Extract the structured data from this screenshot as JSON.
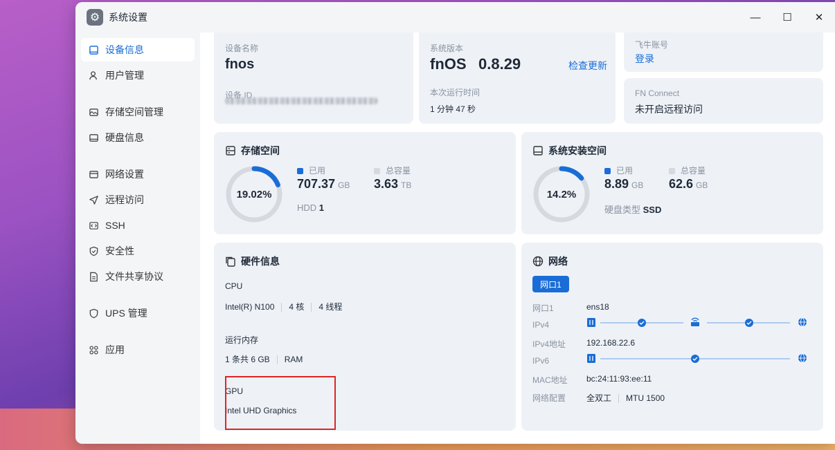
{
  "window": {
    "title": "系统设置",
    "controls": [
      "—",
      "☐",
      "✕"
    ]
  },
  "sidebar": {
    "items": [
      {
        "label": "设备信息",
        "icon": "device-icon",
        "active": true
      },
      {
        "label": "用户管理",
        "icon": "user-icon"
      },
      {
        "label": "存储空间管理",
        "icon": "storage-icon"
      },
      {
        "label": "硬盘信息",
        "icon": "disk-icon"
      },
      {
        "label": "网络设置",
        "icon": "network-icon"
      },
      {
        "label": "远程访问",
        "icon": "send-icon"
      },
      {
        "label": "SSH",
        "icon": "code-icon"
      },
      {
        "label": "安全性",
        "icon": "shield-icon"
      },
      {
        "label": "文件共享协议",
        "icon": "file-icon"
      },
      {
        "label": "UPS 管理",
        "icon": "ups-shield-icon"
      },
      {
        "label": "应用",
        "icon": "apps-icon"
      }
    ]
  },
  "device": {
    "name_label": "设备名称",
    "name": "fnos",
    "id_label": "设备 ID"
  },
  "system": {
    "version_label": "系统版本",
    "os": "fnOS",
    "version": "0.8.29",
    "check_update": "检查更新",
    "uptime_label": "本次运行时间",
    "uptime": "1 分钟 47 秒"
  },
  "account": {
    "label": "飞牛账号",
    "login": "登录"
  },
  "fnconnect": {
    "label": "FN Connect",
    "status": "未开启远程访问"
  },
  "storage": {
    "title": "存储空间",
    "percent_text": "19.02%",
    "percent": 19.02,
    "used_label": "已用",
    "used_value": "707.37",
    "used_unit": "GB",
    "total_label": "总容量",
    "total_value": "3.63",
    "total_unit": "TB",
    "hdd_label": "HDD",
    "hdd_count": "1",
    "used_color": "#1a6dd6",
    "total_color": "#d6dae0"
  },
  "system_space": {
    "title": "系统安装空间",
    "percent_text": "14.2%",
    "percent": 14.2,
    "used_label": "已用",
    "used_value": "8.89",
    "used_unit": "GB",
    "total_label": "总容量",
    "total_value": "62.6",
    "total_unit": "GB",
    "disk_type_label": "硬盘类型",
    "disk_type": "SSD"
  },
  "hardware": {
    "title": "硬件信息",
    "cpu_label": "CPU",
    "cpu_model": "Intel(R) N100",
    "cpu_cores": "4 核",
    "cpu_threads": "4 线程",
    "mem_label": "运行内存",
    "mem_total": "1 条共 6 GB",
    "mem_type": "RAM",
    "gpu_label": "GPU",
    "gpu_model": "Intel UHD Graphics"
  },
  "network": {
    "title": "网络",
    "tab": "网口1",
    "port_label": "网口1",
    "port_value": "ens18",
    "ipv4_label": "IPv4",
    "ipv4_addr_label": "IPv4地址",
    "ipv4_addr": "192.168.22.6",
    "ipv6_label": "IPv6",
    "mac_label": "MAC地址",
    "mac": "bc:24:11:93:ee:11",
    "config_label": "网络配置",
    "duplex": "全双工",
    "mtu": "MTU 1500"
  }
}
